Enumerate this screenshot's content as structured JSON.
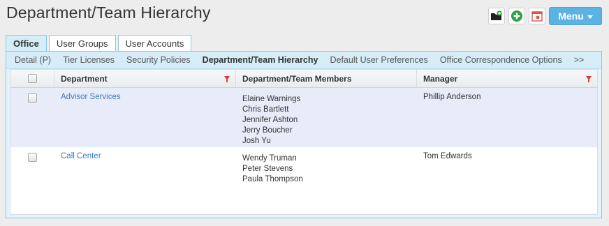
{
  "page": {
    "title": "Department/Team Hierarchy"
  },
  "toolbar": {
    "icons": [
      "folder-add-icon",
      "add-circle-icon",
      "calendar-icon"
    ],
    "menu_label": "Menu"
  },
  "tabs": [
    {
      "label": "Office",
      "active": true
    },
    {
      "label": "User Groups",
      "active": false
    },
    {
      "label": "User Accounts",
      "active": false
    }
  ],
  "subnav": [
    {
      "label": "Detail (P)"
    },
    {
      "label": "Tier Licenses"
    },
    {
      "label": "Security Policies"
    },
    {
      "label": "Department/Team Hierarchy",
      "active": true
    },
    {
      "label": "Default User Preferences"
    },
    {
      "label": "Office Correspondence Options"
    },
    {
      "label": ">>"
    }
  ],
  "grid": {
    "columns": {
      "department": "Department",
      "members": "Department/Team Members",
      "manager": "Manager"
    },
    "rows": [
      {
        "department": "Advisor Services",
        "members": [
          "Elaine Warnings",
          "Chris Bartlett",
          "Jennifer Ashton",
          "Jerry Boucher",
          "Josh Yu"
        ],
        "manager": "Phillip Anderson"
      },
      {
        "department": "Call Center",
        "members": [
          "Wendy Truman",
          "Peter Stevens",
          "Paula Thompson"
        ],
        "manager": "Tom Edwards"
      }
    ]
  },
  "colors": {
    "accent": "#5bb3e4",
    "link": "#3b7bbf",
    "filter": "#e03a3a",
    "selected_row": "#e8ebf8"
  }
}
